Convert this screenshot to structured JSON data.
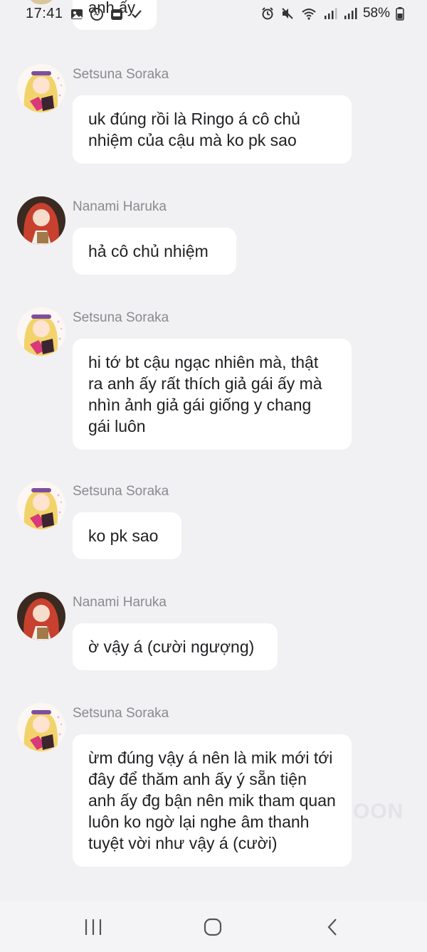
{
  "status_bar": {
    "time": "17:41",
    "battery": "58%",
    "left_icons": [
      "image-icon",
      "messenger-icon",
      "app-icon",
      "check-icon"
    ],
    "right_icons": [
      "alarm-icon",
      "mute-icon",
      "wifi-icon",
      "signal-icon",
      "signal-icon",
      "battery-icon"
    ]
  },
  "top_partial_message": {
    "text": "anh ấy"
  },
  "messages": [
    {
      "sender": "Setsuna Soraka",
      "avatar": "blonde-avatar",
      "text": "uk đúng rồi là Ringo á cô chủ nhiệm của cậu mà ko pk sao"
    },
    {
      "sender": "Nanami Haruka",
      "avatar": "redhead-avatar",
      "text": "hả cô chủ nhiệm"
    },
    {
      "sender": "Setsuna Soraka",
      "avatar": "blonde-avatar",
      "text": "hi tớ bt cậu ngạc nhiên mà, thật ra anh ấy rất thích giả gái ấy mà nhìn ảnh giả gái giống y chang gái luôn"
    },
    {
      "sender": "Setsuna Soraka",
      "avatar": "blonde-avatar",
      "text": "ko pk sao"
    },
    {
      "sender": "Nanami Haruka",
      "avatar": "redhead-avatar",
      "text": "ờ vậy á (cười ngượng)"
    },
    {
      "sender": "Setsuna Soraka",
      "avatar": "blonde-avatar",
      "text": "ừm đúng vậy á nên là mik mới tới đây để thăm anh ấy ý sẵn tiện anh ấy đg bận nên mik tham quan luôn ko ngờ lại nghe âm thanh tuyệt vời như vậy á (cười)"
    }
  ],
  "watermark": "OON",
  "colors": {
    "background": "#f1f1f3",
    "bubble": "#ffffff",
    "sender": "#8a8a8f",
    "text": "#202124"
  },
  "navbar": {
    "buttons": [
      "recents-icon",
      "home-icon",
      "back-icon"
    ]
  }
}
